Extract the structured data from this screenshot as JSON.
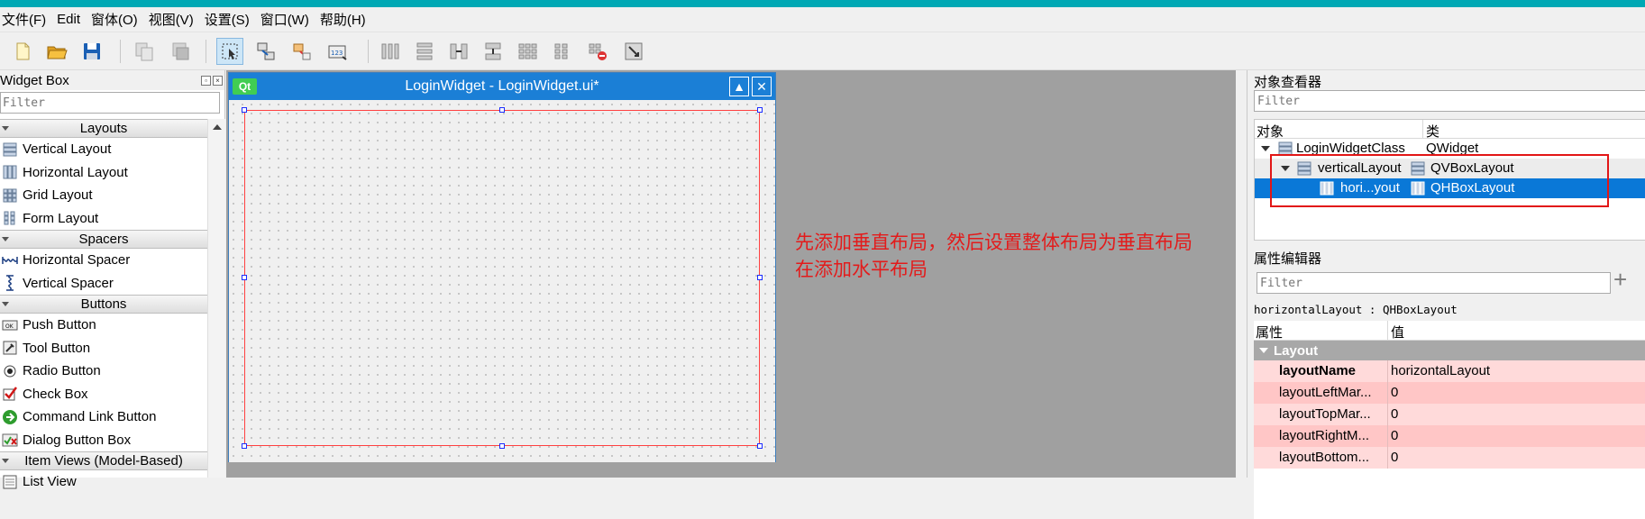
{
  "menubar": {
    "items": [
      "文件(F)",
      "Edit",
      "窗体(O)",
      "视图(V)",
      "设置(S)",
      "窗口(W)",
      "帮助(H)"
    ]
  },
  "toolbar": {
    "icons": [
      "new-file-icon",
      "open-folder-icon",
      "save-icon",
      "copy-icon",
      "paste-icon",
      "edit-widgets-icon",
      "edit-signals-icon",
      "edit-buddies-icon",
      "edit-tab-order-icon",
      "layout-horizontal-icon",
      "layout-vertical-icon",
      "layout-splitter-h-icon",
      "layout-splitter-v-icon",
      "layout-grid-icon",
      "layout-form-icon",
      "break-layout-icon",
      "adjust-size-icon"
    ]
  },
  "widget_box": {
    "title": "Widget Box",
    "filter_placeholder": "Filter",
    "categories": [
      {
        "label": "Layouts",
        "items": [
          "Vertical Layout",
          "Horizontal Layout",
          "Grid Layout",
          "Form Layout"
        ]
      },
      {
        "label": "Spacers",
        "items": [
          "Horizontal Spacer",
          "Vertical Spacer"
        ]
      },
      {
        "label": "Buttons",
        "items": [
          "Push Button",
          "Tool Button",
          "Radio Button",
          "Check Box",
          "Command Link Button",
          "Dialog Button Box"
        ]
      },
      {
        "label": "Item Views (Model-Based)",
        "items": [
          "List View"
        ]
      }
    ]
  },
  "form_window": {
    "logo": "Qt",
    "title": "LoginWidget - LoginWidget.ui*",
    "buttons": [
      "▲",
      "✕"
    ]
  },
  "annotation": {
    "line1": "先添加垂直布局，然后设置整体布局为垂直布局",
    "line2": "在添加水平布局"
  },
  "object_inspector": {
    "title": "对象查看器",
    "filter_placeholder": "Filter",
    "col_object": "对象",
    "col_class": "类",
    "rows": [
      {
        "name": "LoginWidgetClass",
        "class": "QWidget"
      },
      {
        "name": "verticalLayout",
        "class": "QVBoxLayout"
      },
      {
        "name": "hori...yout",
        "class": "QHBoxLayout"
      }
    ]
  },
  "property_editor": {
    "title": "属性编辑器",
    "filter_placeholder": "Filter",
    "identity": "horizontalLayout : QHBoxLayout",
    "col_property": "属性",
    "col_value": "值",
    "group": "Layout",
    "rows": [
      {
        "key": "layoutName",
        "value": "horizontalLayout"
      },
      {
        "key": "layoutLeftMar...",
        "value": "0"
      },
      {
        "key": "layoutTopMar...",
        "value": "0"
      },
      {
        "key": "layoutRightM...",
        "value": "0"
      },
      {
        "key": "layoutBottom...",
        "value": "0"
      }
    ]
  },
  "colors": {
    "accent": "#0a78d7",
    "annotation": "#e31b1b",
    "title_bar": "#1b7fd6"
  }
}
